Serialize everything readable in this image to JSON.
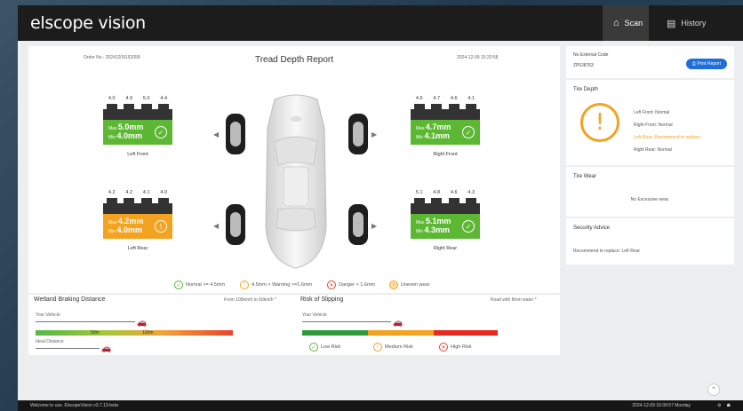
{
  "app": {
    "logo": "elscope vision"
  },
  "nav": {
    "scan": {
      "icon": "home-icon",
      "label": "Scan"
    },
    "history": {
      "icon": "history-icon",
      "label": "History"
    }
  },
  "report": {
    "order_no": "Order No.: 20241209152058",
    "title": "Tread Depth Report",
    "date": "2024-12-09 15:20:58"
  },
  "tires": {
    "left_front": {
      "label": "Left Front",
      "readings": [
        "4.0",
        "4.9",
        "5.0",
        "4.4"
      ],
      "max_label": "Max",
      "max": "5.0mm",
      "min_label": "Min",
      "min": "4.0mm",
      "status": "normal",
      "color": "#5cb833"
    },
    "right_front": {
      "label": "Right Front",
      "readings": [
        "4.6",
        "4.7",
        "4.6",
        "4.1"
      ],
      "max_label": "Max",
      "max": "4.7mm",
      "min_label": "Min",
      "min": "4.1mm",
      "status": "normal",
      "color": "#5cb833"
    },
    "left_rear": {
      "label": "Left Rear",
      "readings": [
        "4.2",
        "4.2",
        "4.1",
        "4.0"
      ],
      "max_label": "Max",
      "max": "4.2mm",
      "min_label": "Min",
      "min": "4.0mm",
      "status": "warning",
      "color": "#f3a320"
    },
    "right_rear": {
      "label": "Right Rear",
      "readings": [
        "5.1",
        "4.8",
        "4.6",
        "4.3"
      ],
      "max_label": "Max",
      "max": "5.1mm",
      "min_label": "Min",
      "min": "4.3mm",
      "status": "normal",
      "color": "#5cb833"
    }
  },
  "legend": {
    "normal": "Normal >= 4.5mm",
    "warning": "4.5mm > Warning >=1.6mm",
    "danger": "Danger < 1.6mm",
    "uneven": "Uneven wear"
  },
  "braking": {
    "title": "Wetland Braking Distance",
    "note": "From 100km/h to 60km/h *",
    "your_vehicle": "Your Vehicle",
    "ideal": "Ideal Distance",
    "mark_50": "50m",
    "mark_100": "100m"
  },
  "slipping": {
    "title": "Risk of Slipping",
    "note": "Road with 8mm water *",
    "your_vehicle": "Your Vehicle",
    "low": "Low Risk",
    "medium": "Medium Risk",
    "high": "High Risk"
  },
  "side": {
    "ext_code_label": "No External Code",
    "ext_code": "ZP0J8763",
    "print": "Print Report",
    "tire_depth": "Tire Depth",
    "lf_status": "Left Front:  Normal",
    "rf_status": "Right Front:  Normal",
    "lr_status": "Left Rear:  Recommend to replace",
    "rr_status": "Right Rear:  Normal",
    "tire_wear": "Tire Wear",
    "wear_text": "No Excessive wear.",
    "security": "Security Advice",
    "advice": "Recommend to replace:  Left Rear"
  },
  "footer": {
    "welcome": "Welcome to use. ElscopeVision v3.7.13-beta",
    "datetime": "2024-12-09 16:09:57 Monday"
  },
  "colors": {
    "green": "#5cb833",
    "orange": "#f3a320",
    "red": "#e6442a",
    "brand_blue": "#1e6fd9"
  }
}
